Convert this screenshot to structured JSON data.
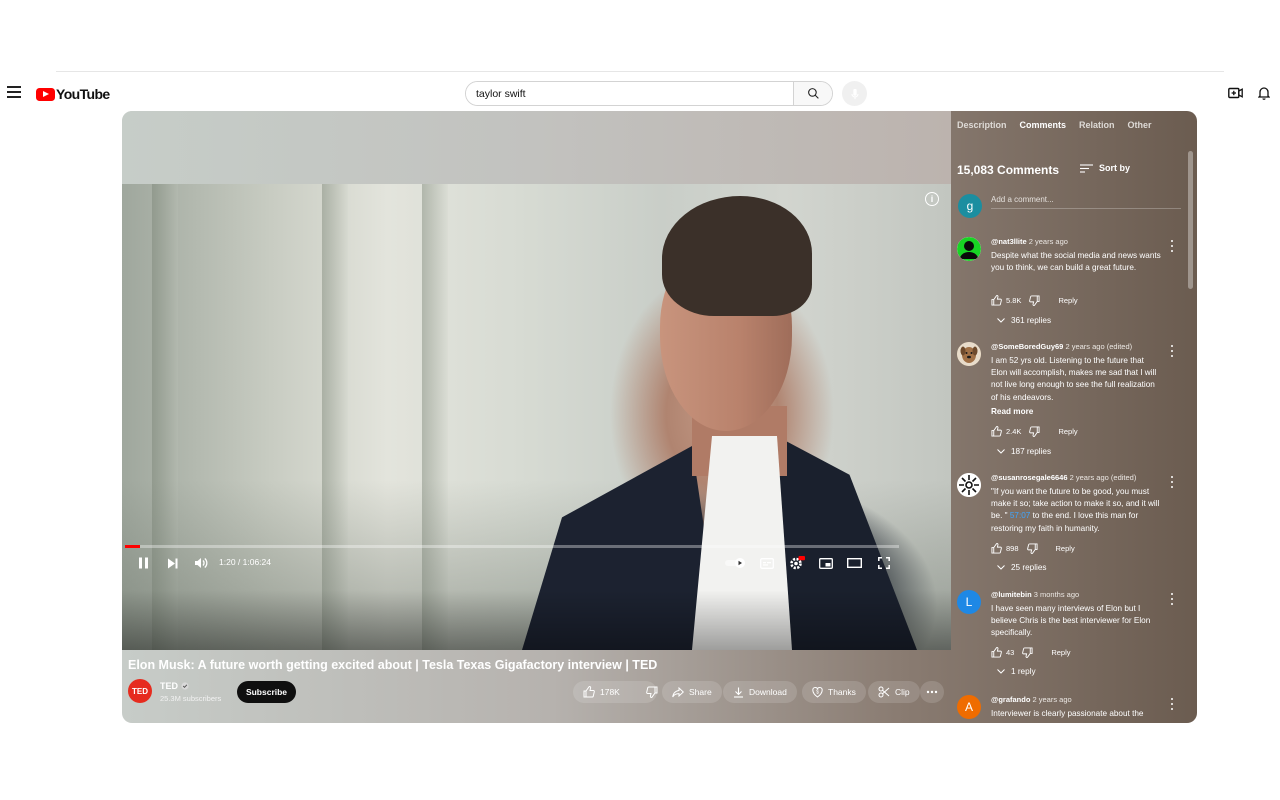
{
  "brand": {
    "logo_text": "YouTube"
  },
  "search": {
    "query": "taylor swift"
  },
  "video": {
    "title": "Elon Musk: A future worth getting excited about | Tesla Texas Gigafactory interview | TED",
    "time": "1:20 / 1:06:24",
    "progress_fraction": 0.02
  },
  "channel": {
    "avatar_text": "TED",
    "name": "TED",
    "subscribers": "25.3M subscribers",
    "subscribe_label": "Subscribe"
  },
  "actions": {
    "likes": "178K",
    "share": "Share",
    "download": "Download",
    "thanks": "Thanks",
    "clip": "Clip"
  },
  "panel": {
    "tabs": [
      "Description",
      "Comments",
      "Relation",
      "Other"
    ],
    "active_tab": "Comments",
    "comment_count": "15,083 Comments",
    "sort_label": "Sort by",
    "add_avatar": "g",
    "add_placeholder": "Add a comment..."
  },
  "comments": [
    {
      "author": "@nat3llite",
      "meta": "2 years ago",
      "text": "Despite what the social media and news wants you to think, we can build a great future.",
      "likes": "5.8K",
      "reply_label": "Reply",
      "replies": "361 replies",
      "avatar_color": "#1fd82b",
      "avatar_text": ""
    },
    {
      "author": "@SomeBoredGuy69",
      "meta": "2 years ago (edited)",
      "text": "I am 52 yrs old.  Listening to the future that Elon will accomplish, makes me sad that I will not live long enough to see the full realization of his endeavors.",
      "read_more": "Read more",
      "likes": "2.4K",
      "reply_label": "Reply",
      "replies": "187 replies",
      "avatar_color": "#a67c52",
      "avatar_text": ""
    },
    {
      "author": "@susanrosegale6646",
      "meta": "2 years ago (edited)",
      "text_before": "\"If you want the future to be good, you must make it so; take action to make it so, and it will be. \" ",
      "text_link": "57:07",
      "text_after": " to the end.  I love this man for restoring my faith in humanity.",
      "likes": "898",
      "reply_label": "Reply",
      "replies": "25 replies",
      "avatar_color": "#ffffff",
      "avatar_text": ""
    },
    {
      "author": "@lumitebin",
      "meta": "3 months ago",
      "text": "I have seen many interviews of Elon but I believe Chris is the best interviewer for Elon specifically.",
      "likes": "43",
      "reply_label": "Reply",
      "replies": "1 reply",
      "avatar_color": "#1e88e5",
      "avatar_text": "L"
    },
    {
      "author": "@grafando",
      "meta": "2 years ago",
      "text": "Interviewer is clearly passionate about the",
      "avatar_color": "#ef6c00",
      "avatar_text": "A"
    }
  ],
  "colors": {
    "brand_red": "#ff0000",
    "progress": "#ff0000",
    "link": "#3ea6ff"
  },
  "icons": [
    "menu-icon",
    "search-icon",
    "mic-icon",
    "create-icon",
    "bell-icon",
    "pause-icon",
    "next-icon",
    "volume-icon",
    "autoplay-toggle",
    "captions-icon",
    "settings-icon",
    "miniplayer-icon",
    "theater-icon",
    "fullscreen-icon",
    "info-icon",
    "thumb-up-icon",
    "thumb-down-icon",
    "share-icon",
    "download-icon",
    "thanks-icon",
    "clip-icon",
    "more-icon",
    "sort-icon",
    "chevron-down-icon"
  ]
}
